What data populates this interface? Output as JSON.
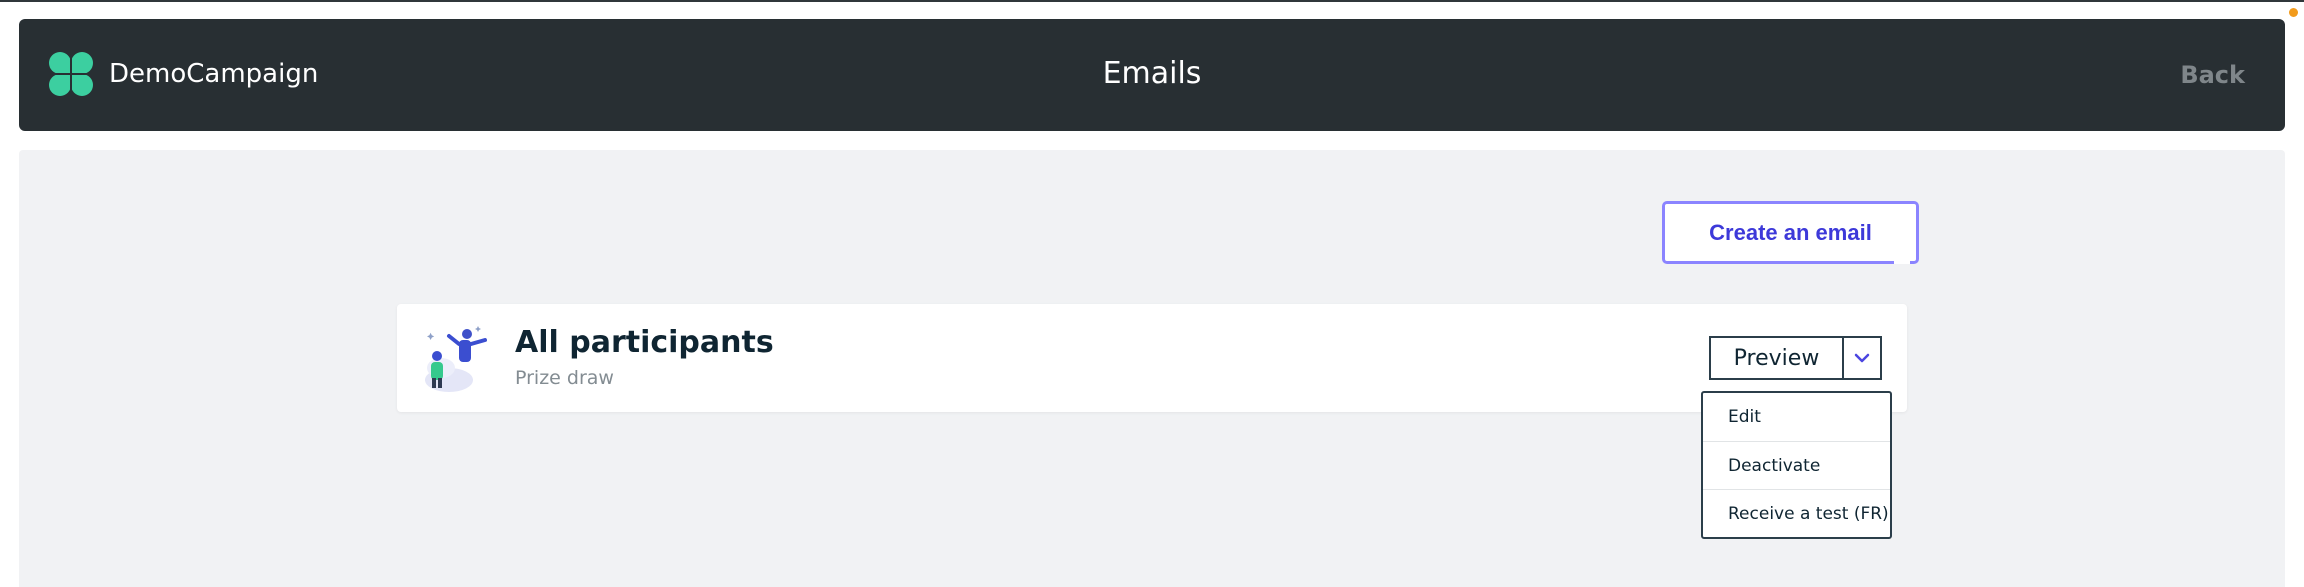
{
  "header": {
    "brand_name": "DemoCampaign",
    "title": "Emails",
    "back_label": "Back",
    "logo_icon": "clover-logo-icon",
    "logo_color": "#3ccfa0",
    "background": "#282f33"
  },
  "actions": {
    "create_email_label": "Create an email",
    "accent_color": "#3d39d9"
  },
  "email_card": {
    "title": "All participants",
    "subtitle": "Prize draw",
    "illustration_icon": "celebrating-people-illustration",
    "preview_label": "Preview",
    "dropdown_icon": "chevron-down-icon"
  },
  "dropdown_menu": {
    "items": [
      {
        "label": "Edit"
      },
      {
        "label": "Deactivate"
      },
      {
        "label": "Receive a test (FR)"
      }
    ]
  },
  "status": {
    "notification_color": "#f29b1c"
  }
}
